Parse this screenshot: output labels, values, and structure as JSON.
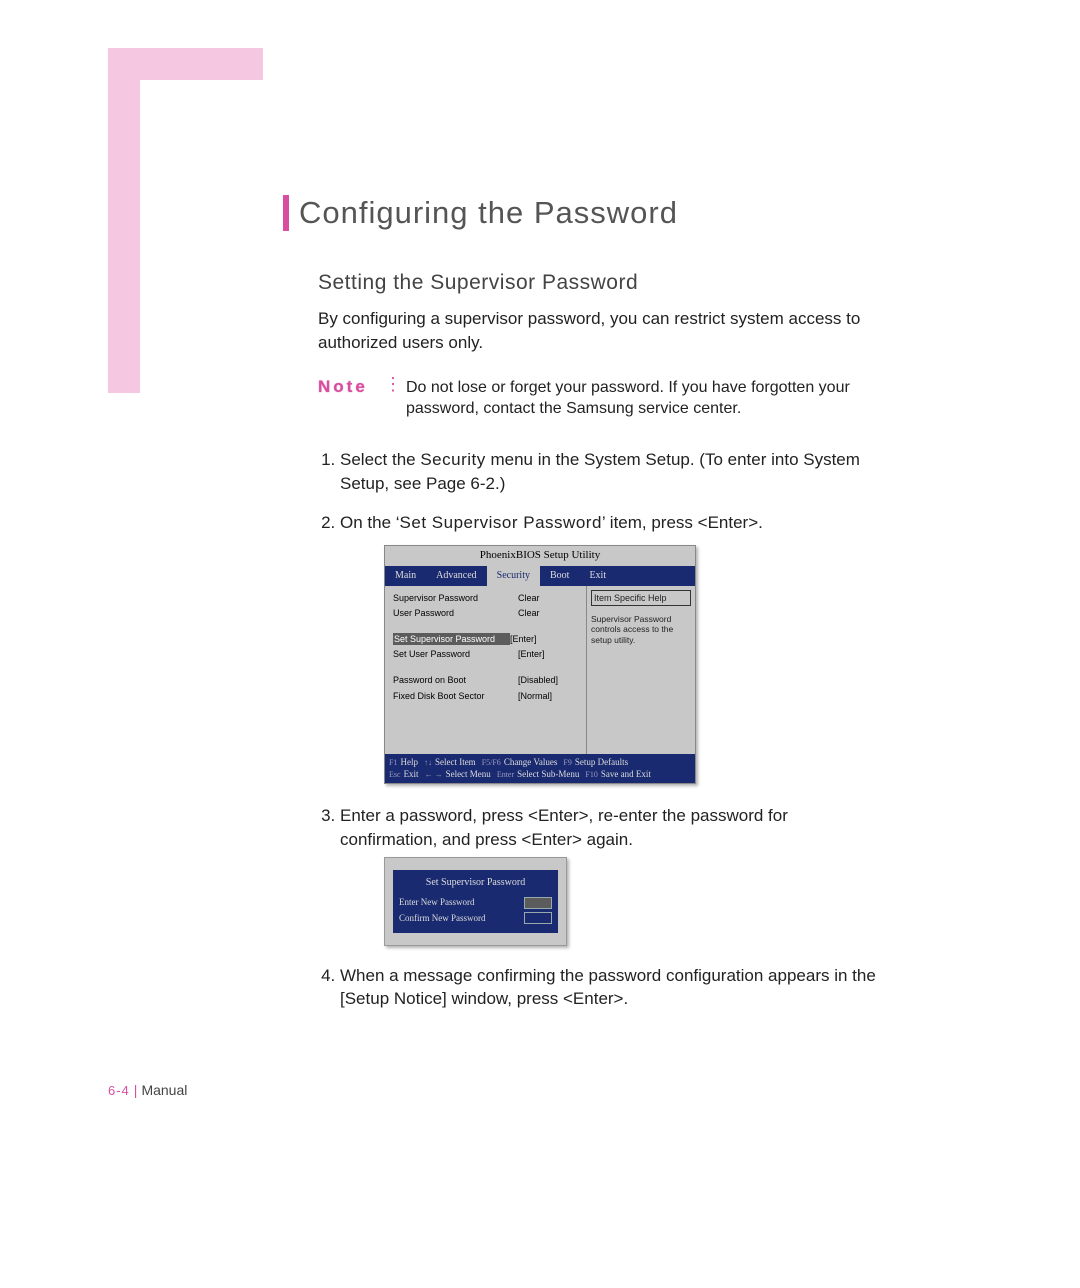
{
  "page": {
    "title": "Configuring the Password",
    "subtitle": "Setting the Supervisor Password",
    "intro": "By configuring a supervisor password, you can restrict system access to authorized users only.",
    "note_label": "Note",
    "note_text": "Do not lose or forget your password. If you have forgotten your password, contact the Samsung service center."
  },
  "steps": {
    "s1a": "Select the ",
    "s1b": "Security",
    "s1c": " menu in the System Setup. (To enter into System Setup, see Page 6-2.)",
    "s2a": "On the ‘",
    "s2b": "Set Supervisor Password",
    "s2c": "’ item, press <Enter>.",
    "s3": "Enter a password, press <Enter>, re-enter the password for confirmation, and press <Enter> again.",
    "s4": "When a message confirming the password configuration appears in the [Setup Notice] window, press <Enter>."
  },
  "bios": {
    "utility_title": "PhoenixBIOS  Setup Utility",
    "tabs": {
      "main": "Main",
      "advanced": "Advanced",
      "security": "Security",
      "boot": "Boot",
      "exit": "Exit"
    },
    "rows": {
      "sup_pw": "Supervisor Password",
      "sup_pw_v": "Clear",
      "usr_pw": "User Password",
      "usr_pw_v": "Clear",
      "set_sup": "Set Supervisor Password",
      "set_sup_v": "[Enter]",
      "set_usr": "Set User Password",
      "set_usr_v": "[Enter]",
      "pw_boot": "Password on Boot",
      "pw_boot_v": "[Disabled]",
      "fdbs": "Fixed Disk Boot Sector",
      "fdbs_v": "[Normal]"
    },
    "help_title": "Item Specific Help",
    "help_text": "Supervisor Password controls access to the setup utility.",
    "footer": {
      "f1": "F1",
      "help": "Help",
      "updn": "↑↓",
      "sel_item": "Select Item",
      "f5f6": "F5/F6",
      "chg": "Change Values",
      "f9": "F9",
      "defs": "Setup Defaults",
      "esc": "Esc",
      "exit": "Exit",
      "lr": "← →",
      "sel_menu": "Select Menu",
      "enter": "Enter",
      "sub": "Select Sub-Menu",
      "f10": "F10",
      "save": "Save and Exit"
    }
  },
  "pwdlg": {
    "title": "Set Supervisor Password",
    "enter": "Enter New Password",
    "confirm": "Confirm New Password"
  },
  "footer": {
    "page_num": "6-4",
    "label": "Manual"
  }
}
